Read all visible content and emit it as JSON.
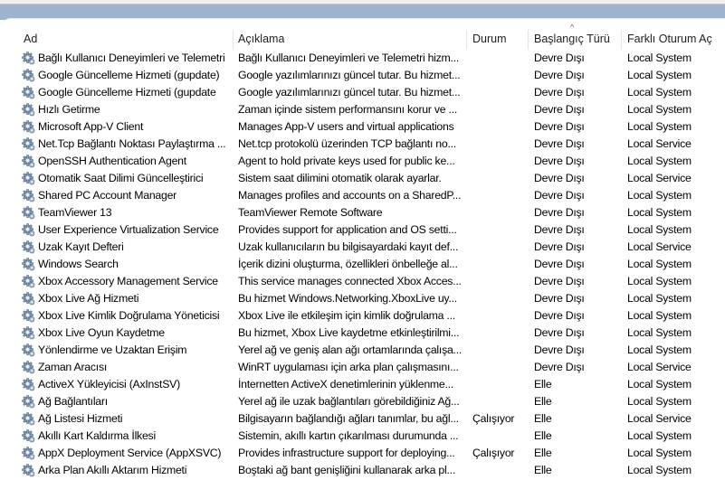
{
  "columns": [
    "Ad",
    "Açıklama",
    "Durum",
    "Başlangıç Türü",
    "Farklı Oturum Aç"
  ],
  "rows": [
    [
      "Bağlı Kullanıcı Deneyimleri ve Telemetri",
      "Bağlı Kullanıcı Deneyimleri ve Telemetri hizm...",
      "",
      "Devre Dışı",
      "Local System"
    ],
    [
      "Google Güncelleme Hizmeti (gupdate)",
      "Google yazılımlarınızı güncel tutar. Bu hizmet...",
      "",
      "Devre Dışı",
      "Local System"
    ],
    [
      "Google Güncelleme Hizmeti (gupdate",
      "Google yazılımlarınızı güncel tutar. Bu hizmet...",
      "",
      "Devre Dışı",
      "Local System"
    ],
    [
      "Hızlı Getirme",
      "Zaman içinde sistem performansını korur ve ...",
      "",
      "Devre Dışı",
      "Local System"
    ],
    [
      "Microsoft App-V Client",
      "Manages App-V users and virtual applications",
      "",
      "Devre Dışı",
      "Local System"
    ],
    [
      "Net.Tcp Bağlantı Noktası Paylaştırma ...",
      "Net.tcp protokolü üzerinden TCP bağlantı no...",
      "",
      "Devre Dışı",
      "Local Service"
    ],
    [
      "OpenSSH Authentication Agent",
      "Agent to hold private keys used for public ke...",
      "",
      "Devre Dışı",
      "Local System"
    ],
    [
      "Otomatik Saat Dilimi Güncelleştirici",
      "Sistem saat dilimini otomatik olarak ayarlar.",
      "",
      "Devre Dışı",
      "Local Service"
    ],
    [
      "Shared PC Account Manager",
      "Manages profiles and accounts on a SharedP...",
      "",
      "Devre Dışı",
      "Local System"
    ],
    [
      "TeamViewer 13",
      "TeamViewer Remote Software",
      "",
      "Devre Dışı",
      "Local System"
    ],
    [
      "User Experience Virtualization Service",
      "Provides support for application and OS setti...",
      "",
      "Devre Dışı",
      "Local System"
    ],
    [
      "Uzak Kayıt Defteri",
      "Uzak kullanıcıların bu bilgisayardaki kayıt def...",
      "",
      "Devre Dışı",
      "Local Service"
    ],
    [
      "Windows Search",
      "İçerik dizini oluşturma, özellikleri önbelleğe al...",
      "",
      "Devre Dışı",
      "Local System"
    ],
    [
      "Xbox Accessory Management Service",
      "This service manages connected Xbox Acces...",
      "",
      "Devre Dışı",
      "Local System"
    ],
    [
      "Xbox Live Ağ Hizmeti",
      "Bu hizmet Windows.Networking.XboxLive uy...",
      "",
      "Devre Dışı",
      "Local System"
    ],
    [
      "Xbox Live Kimlik Doğrulama Yöneticisi",
      "Xbox Live ile etkileşim için kimlik doğrulama ...",
      "",
      "Devre Dışı",
      "Local System"
    ],
    [
      "Xbox Live Oyun Kaydetme",
      "Bu hizmet, Xbox Live kaydetme etkinleştirilmi...",
      "",
      "Devre Dışı",
      "Local System"
    ],
    [
      "Yönlendirme ve Uzaktan Erişim",
      "Yerel ağ ve geniş alan ağı ortamlarında çalışa...",
      "",
      "Devre Dışı",
      "Local System"
    ],
    [
      "Zaman Aracısı",
      "WinRT uygulaması için arka plan çalışmasını...",
      "",
      "Devre Dışı",
      "Local Service"
    ],
    [
      "ActiveX Yükleyicisi (AxInstSV)",
      "İnternetten ActiveX denetimlerinin yüklenme...",
      "",
      "Elle",
      "Local System"
    ],
    [
      "Ağ Bağlantıları",
      "Yerel ağ ile uzak bağlantıları görebildiğiniz Ağ...",
      "",
      "Elle",
      "Local System"
    ],
    [
      "Ağ Listesi Hizmeti",
      "Bilgisayarın bağlandığı ağları tanımlar, bu ağl...",
      "Çalışıyor",
      "Elle",
      "Local Service"
    ],
    [
      "Akıllı Kart Kaldırma İlkesi",
      "Sistemin, akıllı kartın çıkarılması durumunda ...",
      "",
      "Elle",
      "Local System"
    ],
    [
      "AppX Deployment Service (AppXSVC)",
      "Provides infrastructure support for deploying...",
      "Çalışıyor",
      "Elle",
      "Local System"
    ],
    [
      "Arka Plan Akıllı Aktarım Hizmeti",
      "Boştaki ağ bant genişliğini kullanarak arka pl...",
      "",
      "Elle",
      "Local System"
    ]
  ]
}
